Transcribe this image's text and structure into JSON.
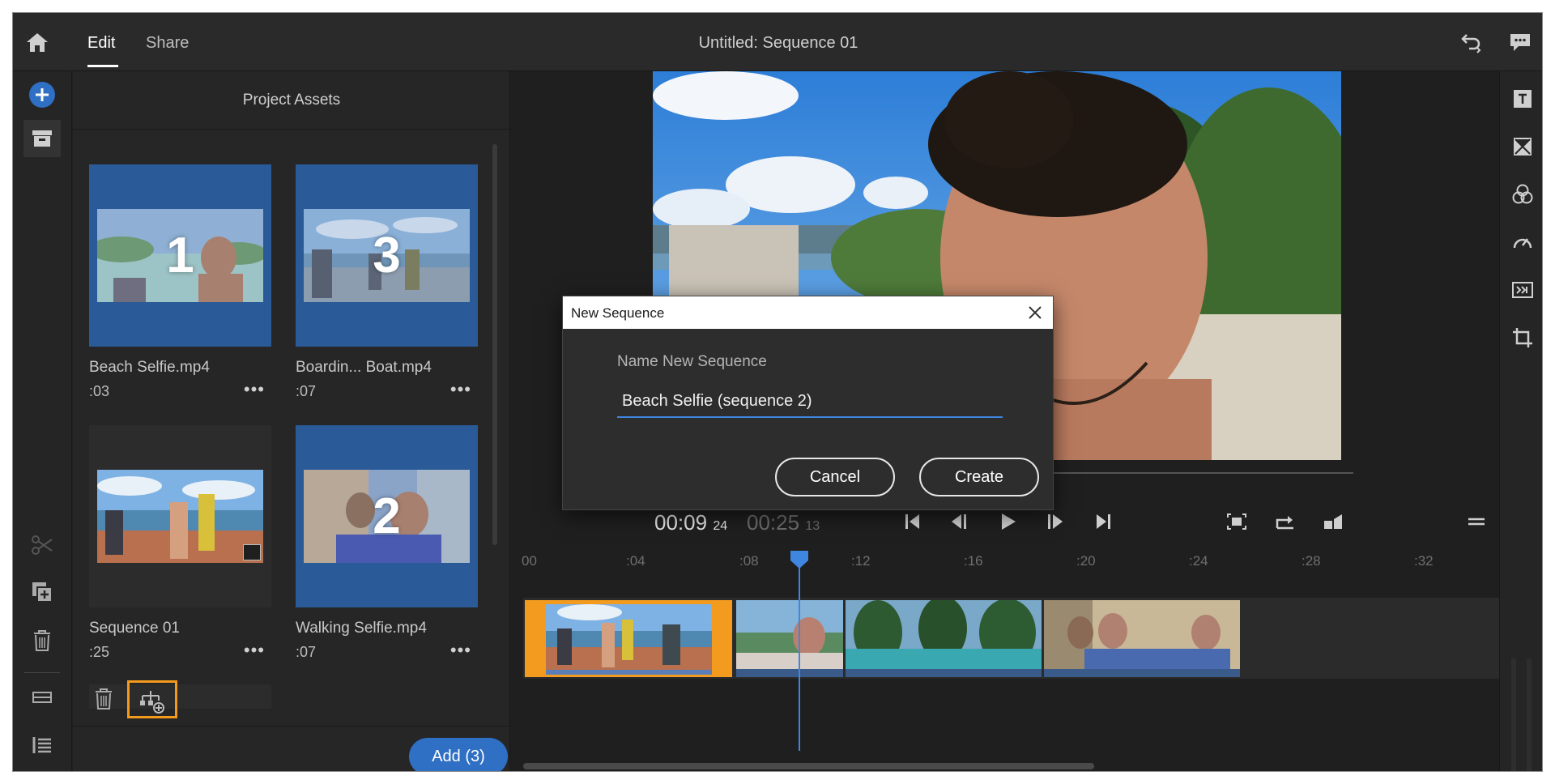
{
  "topbar": {
    "tabs": [
      {
        "label": "Edit"
      },
      {
        "label": "Share"
      }
    ],
    "title": "Untitled: Sequence 01"
  },
  "assets": {
    "header": "Project Assets",
    "items": [
      {
        "name": "Beach Selfie.mp4",
        "duration": ":03",
        "number": "1",
        "selected": true
      },
      {
        "name": "Boardin... Boat.mp4",
        "duration": ":07",
        "number": "3",
        "selected": true
      },
      {
        "name": "Sequence 01",
        "duration": ":25",
        "number": "",
        "selected": false
      },
      {
        "name": "Walking Selfie.mp4",
        "duration": ":07",
        "number": "2",
        "selected": true
      }
    ],
    "more_label": "•••",
    "add_button": "Add (3)"
  },
  "transport": {
    "current_time": "00:09",
    "current_frames": "24",
    "total_time": "00:25",
    "total_frames": "13"
  },
  "timeline": {
    "ruler": [
      "00",
      ":04",
      ":08",
      ":12",
      ":16",
      ":20",
      ":24",
      ":28",
      ":32"
    ]
  },
  "dialog": {
    "title": "New Sequence",
    "field_label": "Name New Sequence",
    "field_value": "Beach Selfie (sequence 2)",
    "cancel": "Cancel",
    "create": "Create"
  },
  "colors": {
    "accent_blue": "#2f6fc4",
    "selection_blue": "#2a5a98",
    "highlight_orange": "#f39a1e",
    "playhead_blue": "#3f86e0"
  }
}
